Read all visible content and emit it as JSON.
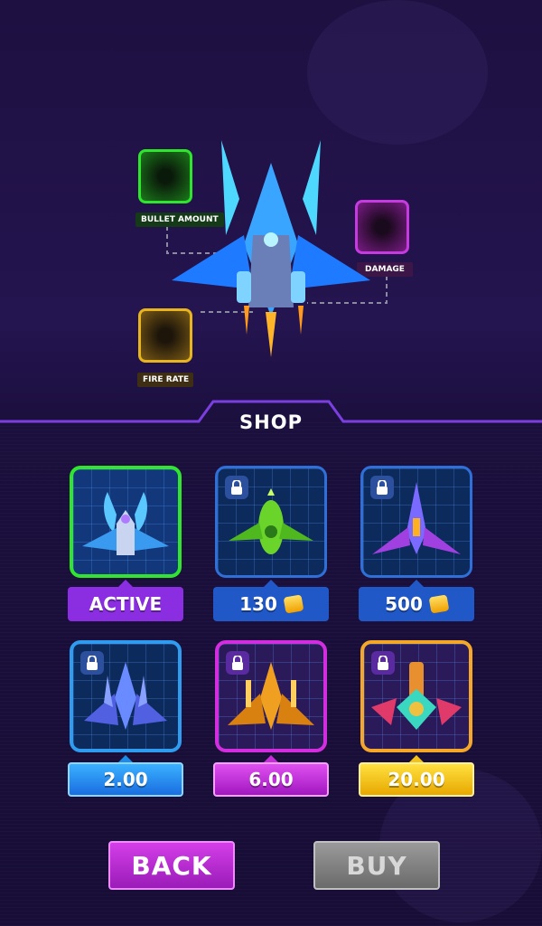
{
  "upgrades": {
    "bullet_amount": {
      "label": "BULLET AMOUNT",
      "color": "#26d62a"
    },
    "damage": {
      "label": "DAMAGE",
      "color": "#c02ad9"
    },
    "fire_rate": {
      "label": "FIRE RATE",
      "color": "#e6b21d"
    }
  },
  "shop": {
    "title": "SHOP",
    "items": [
      {
        "status": "active",
        "label": "ACTIVE",
        "locked": false
      },
      {
        "status": "locked",
        "price": "130",
        "currency_icon": "gem-coin-icon",
        "locked": true
      },
      {
        "status": "locked",
        "price": "500",
        "currency_icon": "gem-coin-icon",
        "locked": true
      },
      {
        "status": "purchasable",
        "price": "2.00",
        "locked": true
      },
      {
        "status": "purchasable",
        "price": "6.00",
        "locked": true
      },
      {
        "status": "purchasable",
        "price": "20.00",
        "locked": true
      }
    ]
  },
  "buttons": {
    "back": "BACK",
    "buy": "BUY"
  },
  "colors": {
    "active": "#8b2de0",
    "price_blue": "#2058c8",
    "premium_blue": "#1f8be8",
    "premium_purple": "#c62ed8",
    "premium_gold": "#f3c21a",
    "back": "#c22bd9",
    "buy_disabled": "#8a8a8a"
  }
}
